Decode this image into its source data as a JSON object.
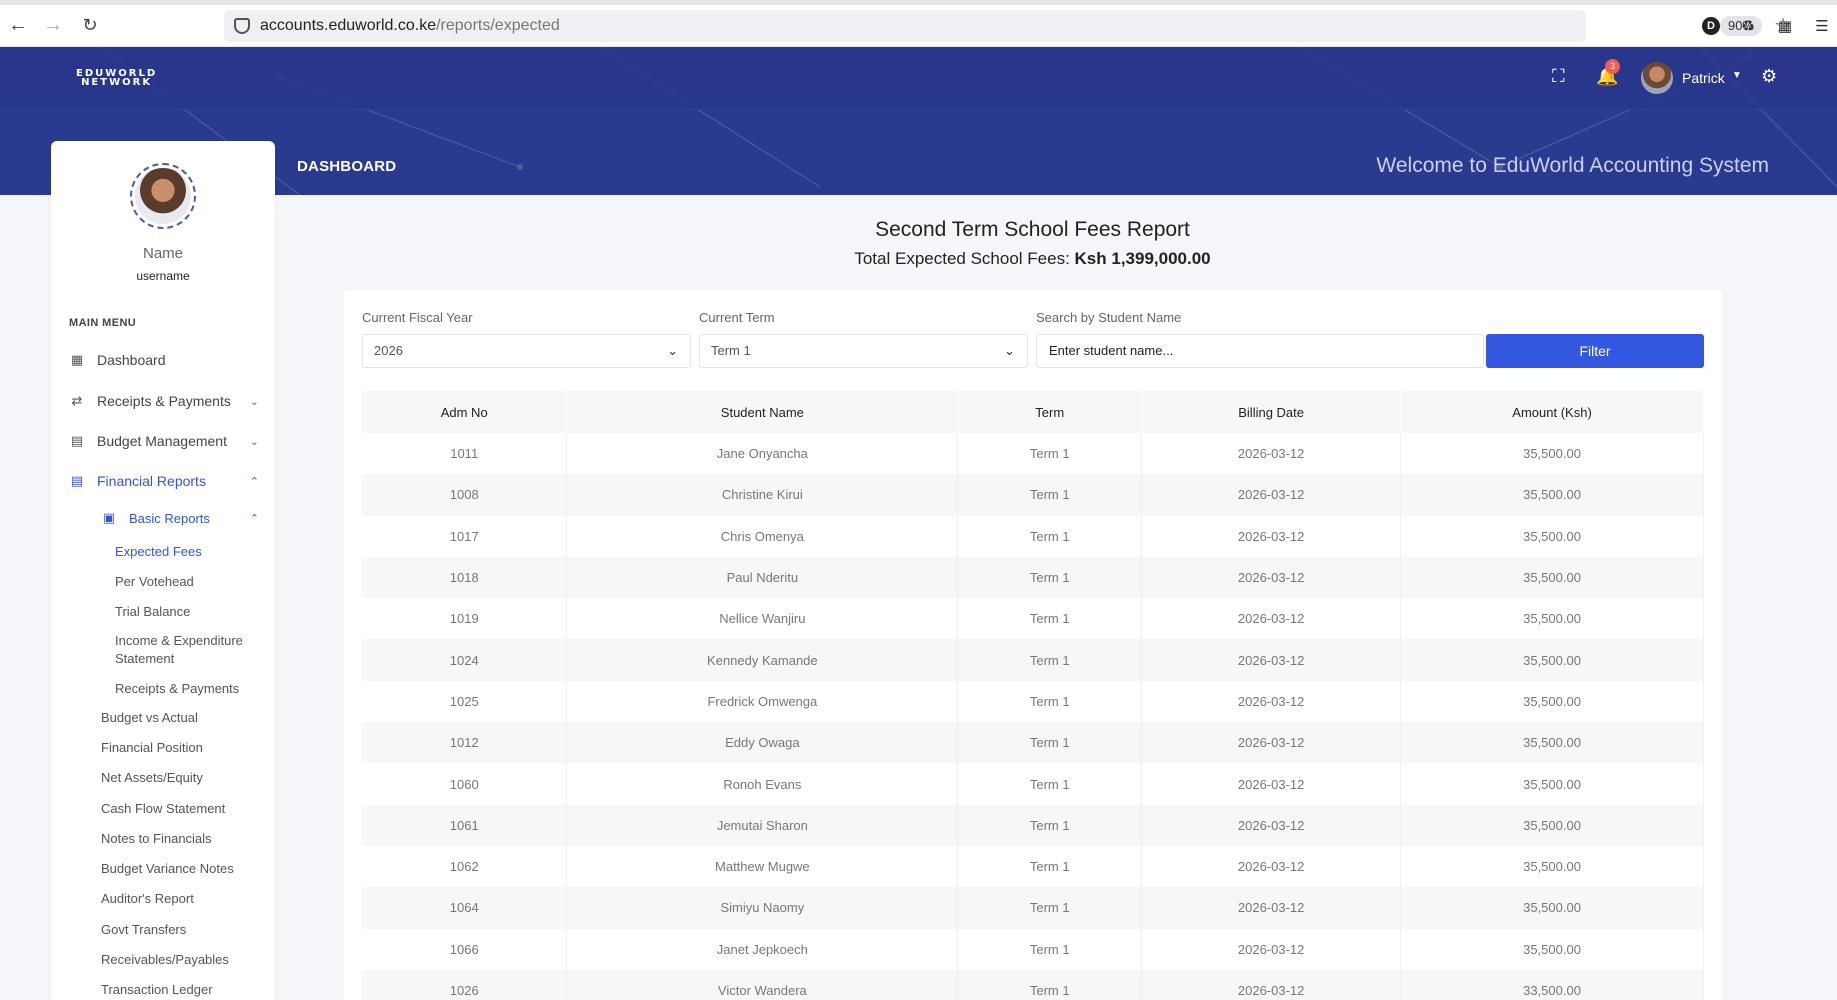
{
  "browser": {
    "url_domain": "accounts.eduworld.co.ke",
    "url_path": "/reports/expected",
    "zoom": "90%",
    "extension_d": "D"
  },
  "header": {
    "logo_line1": "EDUWORLD",
    "logo_line2": "NETWORK",
    "notifications_count": "3",
    "user_name": "Patrick",
    "page_label": "DASHBOARD",
    "welcome": "Welcome to EduWorld Accounting System"
  },
  "sidebar": {
    "name": "Name",
    "username": "username",
    "menu_title": "MAIN MENU",
    "dashboard": "Dashboard",
    "receipts_payments": "Receipts & Payments",
    "budget_management": "Budget Management",
    "financial_reports": "Financial Reports",
    "basic_reports": "Basic Reports",
    "sub_items": [
      "Expected Fees",
      "Per Votehead",
      "Trial Balance",
      "Income & Expenditure Statement",
      "Receipts & Payments"
    ],
    "plain_items": [
      "Budget vs Actual",
      "Financial Position",
      "Net Assets/Equity",
      "Cash Flow Statement",
      "Notes to Financials",
      "Budget Variance Notes",
      "Auditor's Report",
      "Govt Transfers",
      "Receivables/Payables",
      "Transaction Ledger"
    ]
  },
  "report": {
    "title": "Second Term School Fees Report",
    "total_label": "Total Expected School Fees: ",
    "total_value": "Ksh 1,399,000.00"
  },
  "filters": {
    "fiscal_year_label": "Current Fiscal Year",
    "fiscal_year_value": "2026",
    "term_label": "Current Term",
    "term_value": "Term 1",
    "search_label": "Search by Student Name",
    "search_placeholder": "Enter student name...",
    "filter_button": "Filter"
  },
  "table": {
    "headers": [
      "Adm No",
      "Student Name",
      "Term",
      "Billing Date",
      "Amount (Ksh)"
    ],
    "rows": [
      [
        "1011",
        "Jane Onyancha",
        "Term 1",
        "2026-03-12",
        "35,500.00"
      ],
      [
        "1008",
        "Christine Kirui",
        "Term 1",
        "2026-03-12",
        "35,500.00"
      ],
      [
        "1017",
        "Chris Omenya",
        "Term 1",
        "2026-03-12",
        "35,500.00"
      ],
      [
        "1018",
        "Paul Nderitu",
        "Term 1",
        "2026-03-12",
        "35,500.00"
      ],
      [
        "1019",
        "Nellice Wanjiru",
        "Term 1",
        "2026-03-12",
        "35,500.00"
      ],
      [
        "1024",
        "Kennedy Kamande",
        "Term 1",
        "2026-03-12",
        "35,500.00"
      ],
      [
        "1025",
        "Fredrick Omwenga",
        "Term 1",
        "2026-03-12",
        "35,500.00"
      ],
      [
        "1012",
        "Eddy Owaga",
        "Term 1",
        "2026-03-12",
        "35,500.00"
      ],
      [
        "1060",
        "Ronoh Evans",
        "Term 1",
        "2026-03-12",
        "35,500.00"
      ],
      [
        "1061",
        "Jemutai Sharon",
        "Term 1",
        "2026-03-12",
        "35,500.00"
      ],
      [
        "1062",
        "Matthew Mugwe",
        "Term 1",
        "2026-03-12",
        "35,500.00"
      ],
      [
        "1064",
        "Simiyu Naomy",
        "Term 1",
        "2026-03-12",
        "35,500.00"
      ],
      [
        "1066",
        "Janet Jepkoech",
        "Term 1",
        "2026-03-12",
        "35,500.00"
      ],
      [
        "1026",
        "Victor Wandera",
        "Term 1",
        "2026-03-12",
        "33,500.00"
      ]
    ]
  },
  "colors": {
    "header_bg": "#2a3a8f",
    "accent": "#3357e0",
    "active_menu": "#3553d9",
    "badge": "#f25c54"
  }
}
